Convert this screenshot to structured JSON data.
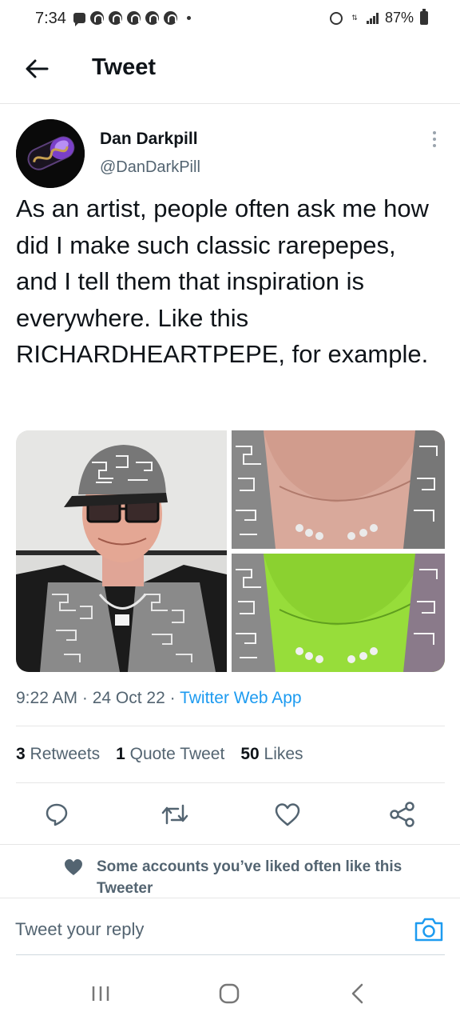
{
  "status_bar": {
    "time": "7:34",
    "battery": "87%"
  },
  "header": {
    "title": "Tweet"
  },
  "tweet": {
    "author_name": "Dan Darkpill",
    "author_handle": "@DanDarkPill",
    "text": "As an artist, people often ask me how did I make such classic rarepepes, and I tell them that inspiration is everywhere.  Like this RICHARDHEARTPEPE, for example.",
    "time": "9:22 AM",
    "date": "24 Oct 22",
    "source": "Twitter Web App",
    "stats": {
      "retweets_count": "3",
      "retweets_label": "Retweets",
      "quotes_count": "1",
      "quotes_label": "Quote Tweet",
      "likes_count": "50",
      "likes_label": "Likes"
    }
  },
  "icons": [
    "back-arrow-icon",
    "more-vertical-icon",
    "reply-icon",
    "retweet-icon",
    "like-icon",
    "share-icon",
    "heart-icon",
    "camera-icon"
  ],
  "liked_note": {
    "text": "Some accounts you’ve liked often like this Tweeter"
  },
  "reply": {
    "placeholder": "Tweet your reply"
  },
  "colors": {
    "accent": "#1d9bf0",
    "text_primary": "#0f1419",
    "text_secondary": "#536471"
  }
}
